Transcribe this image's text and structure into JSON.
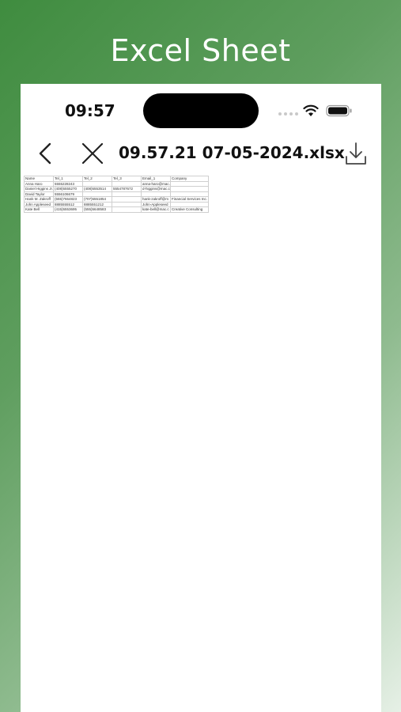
{
  "promo": {
    "title": "Excel Sheet"
  },
  "status_bar": {
    "time": "09:57",
    "icons": [
      "wifi-icon",
      "battery-icon"
    ]
  },
  "nav": {
    "back_icon": "chevron-left-icon",
    "close_icon": "close-icon",
    "file_name": "09.57.21 07-05-2024.xlsx",
    "download_icon": "download-icon"
  },
  "sheet": {
    "headers": [
      "Name",
      "Tel_1",
      "Tel_2",
      "Tel_3",
      "Email_1",
      "Company"
    ],
    "rows": [
      [
        "Anna Haro",
        "5555228243",
        "",
        "",
        "anna-haro@mac.",
        ""
      ],
      [
        "Daniel Higgins Jr.",
        "(408)5555270",
        "(408)5553514",
        "5554787672",
        "d-higgins@mac.c",
        ""
      ],
      [
        "David Taylor",
        "5556106679",
        "",
        "",
        "",
        ""
      ],
      [
        "Hank M. Zakroff",
        "(555)7664823",
        "(707)5551854",
        "",
        "hank-zakroff@m",
        "Financial Services Inc."
      ],
      [
        "John Appleseed",
        "8885555512",
        "8885551212",
        "",
        "John-Appleseed",
        ""
      ],
      [
        "Kate Bell",
        "(415)5553695",
        "(555)5648583",
        "",
        "kate-bell@mac.c",
        "Creative Consulting"
      ]
    ]
  },
  "colors": {
    "gradient_start": "#3f8c3f",
    "gradient_end": "#e6f0e6"
  }
}
